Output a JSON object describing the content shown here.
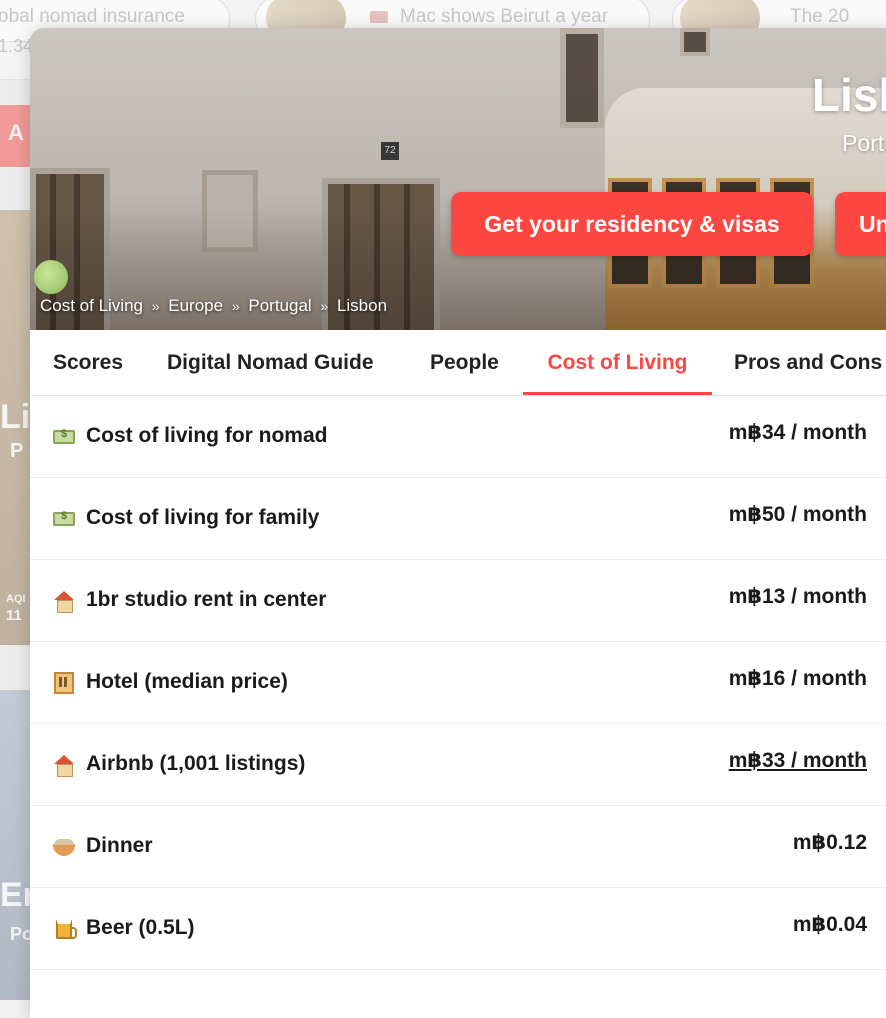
{
  "background": {
    "pills": [
      {
        "text": "obal nomad insurance",
        "sub": "1.34"
      },
      {
        "text": "Mac shows Beirut a year"
      },
      {
        "text": "The 20"
      }
    ],
    "side_labels": {
      "a": "A",
      "city_partial": "Li",
      "country_partial": "P",
      "aqi_label": "AQI",
      "aqi_value": "11",
      "city2_partial": "Er",
      "country2_partial": "Po"
    }
  },
  "hero": {
    "city": "Lisbon",
    "country": "Portugal",
    "doorplate": "72",
    "buttons": {
      "residency": "Get your residency & visas",
      "second": "Un"
    },
    "breadcrumb": [
      "Cost of Living",
      "Europe",
      "Portugal",
      "Lisbon"
    ],
    "breadcrumb_sep": "»"
  },
  "tabs": [
    {
      "label": "Scores",
      "active": false
    },
    {
      "label": "Digital Nomad Guide",
      "active": false
    },
    {
      "label": "People",
      "active": false
    },
    {
      "label": "Cost of Living",
      "active": true
    },
    {
      "label": "Pros and Cons",
      "active": false
    }
  ],
  "accent_color": "#ff4742",
  "rows": [
    {
      "icon": "money-icon",
      "label": "Cost of living for nomad",
      "value": "m฿34 / month",
      "link": false
    },
    {
      "icon": "money-icon",
      "label": "Cost of living for family",
      "value": "m฿50 / month",
      "link": false
    },
    {
      "icon": "house-icon",
      "label": "1br studio rent in center",
      "value": "m฿13 / month",
      "link": false
    },
    {
      "icon": "hotel-icon",
      "label": "Hotel (median price)",
      "value": "m฿16 / month",
      "link": false
    },
    {
      "icon": "house-icon",
      "label": "Airbnb (1,001 listings)",
      "value": "m฿33 / month",
      "link": true
    },
    {
      "icon": "bowl-icon",
      "label": "Dinner",
      "value": "m฿0.12",
      "link": false
    },
    {
      "icon": "beer-icon",
      "label": "Beer (0.5L)",
      "value": "m฿0.04",
      "link": false
    }
  ]
}
